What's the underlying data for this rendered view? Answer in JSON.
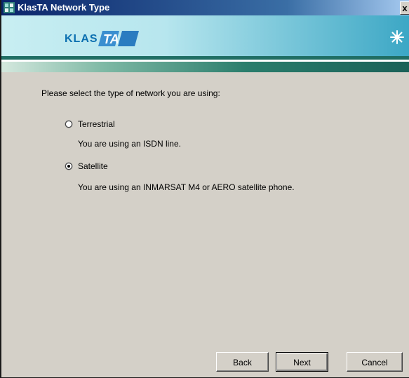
{
  "window": {
    "title": "KlasTA Network Type",
    "close_label": "x"
  },
  "banner": {
    "logo_text": "KLAS",
    "logo_suffix": "TA"
  },
  "prompt": "Please select the type of network you are using:",
  "options": [
    {
      "label": "Terrestrial",
      "description": "You are using an ISDN line.",
      "selected": false
    },
    {
      "label": "Satellite",
      "description": "You are using an INMARSAT M4 or AERO satellite phone.",
      "selected": true
    }
  ],
  "buttons": {
    "back": "Back",
    "next": "Next",
    "cancel": "Cancel"
  },
  "colors": {
    "titlebar": "#0a246a",
    "face": "#d4d0c8",
    "accent": "#1f6e64",
    "logo": "#0b6fb0"
  }
}
